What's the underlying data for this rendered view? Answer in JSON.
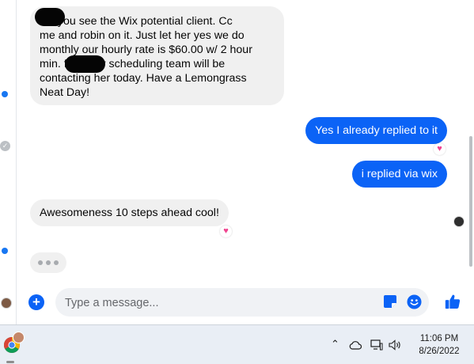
{
  "conversation": {
    "messages": [
      {
        "direction": "incoming",
        "text": "did you see the Wix potential client. Cc\nme and robin on it. Just let her yes we do\nmonthly our hourly rate is $60.00 w/ 2 hour\nmin.            from our scheduling team will be\ncontacting her today. Have a Lemongrass\nNeat Day!",
        "redacted": true
      },
      {
        "direction": "outgoing",
        "text": "Yes I already replied to it",
        "reaction": "heart"
      },
      {
        "direction": "outgoing",
        "text": "i replied via wix"
      },
      {
        "direction": "incoming",
        "text": "Awesomeness 10 steps ahead cool!",
        "reaction": "heart"
      }
    ],
    "typing_indicator": true
  },
  "composer": {
    "placeholder": "Type a message...",
    "value": "",
    "icons": [
      "plus-icon",
      "sticker-icon",
      "emoji-icon",
      "thumbs-up-icon"
    ]
  },
  "taskbar": {
    "apps": [
      "chrome-icon"
    ],
    "tray_icons": [
      "chevron-up-icon",
      "cloud-icon",
      "display-icon",
      "volume-icon"
    ],
    "time": "11:06 PM",
    "date": "8/26/2022"
  },
  "colors": {
    "accent": "#0b63f6",
    "incoming_bubble": "#f0f0f0",
    "heart": "#f0438f"
  }
}
